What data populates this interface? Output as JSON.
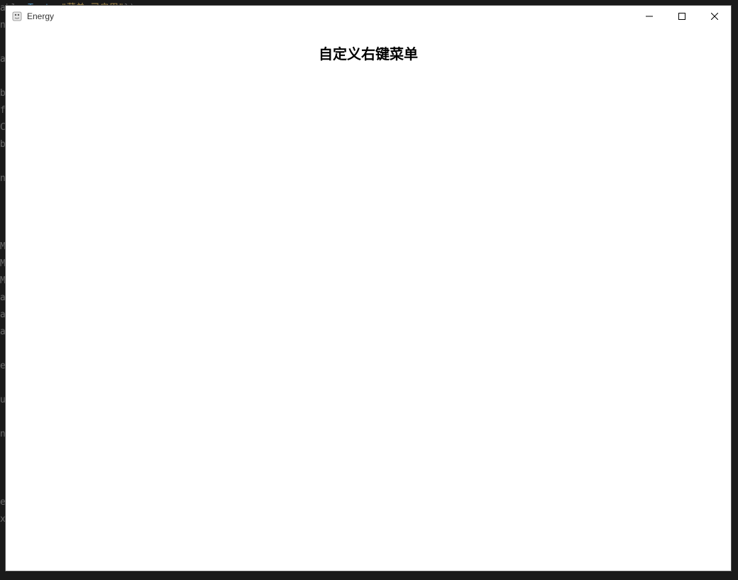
{
  "window": {
    "title": "Energy"
  },
  "content": {
    "heading": "自定义右键菜单"
  },
  "background_code": {
    "lines": [
      "able   Text: \"菜单-已启用\"})",
      "n",
      "",
      "a",
      "",
      "b",
      "f",
      "C",
      "b",
      "",
      "n",
      "",
      "",
      "",
      "M",
      "M",
      "M",
      "a",
      "a",
      "a",
      "",
      "e",
      "",
      "u",
      "",
      "n",
      "",
      "",
      "",
      "e",
      "x"
    ]
  }
}
